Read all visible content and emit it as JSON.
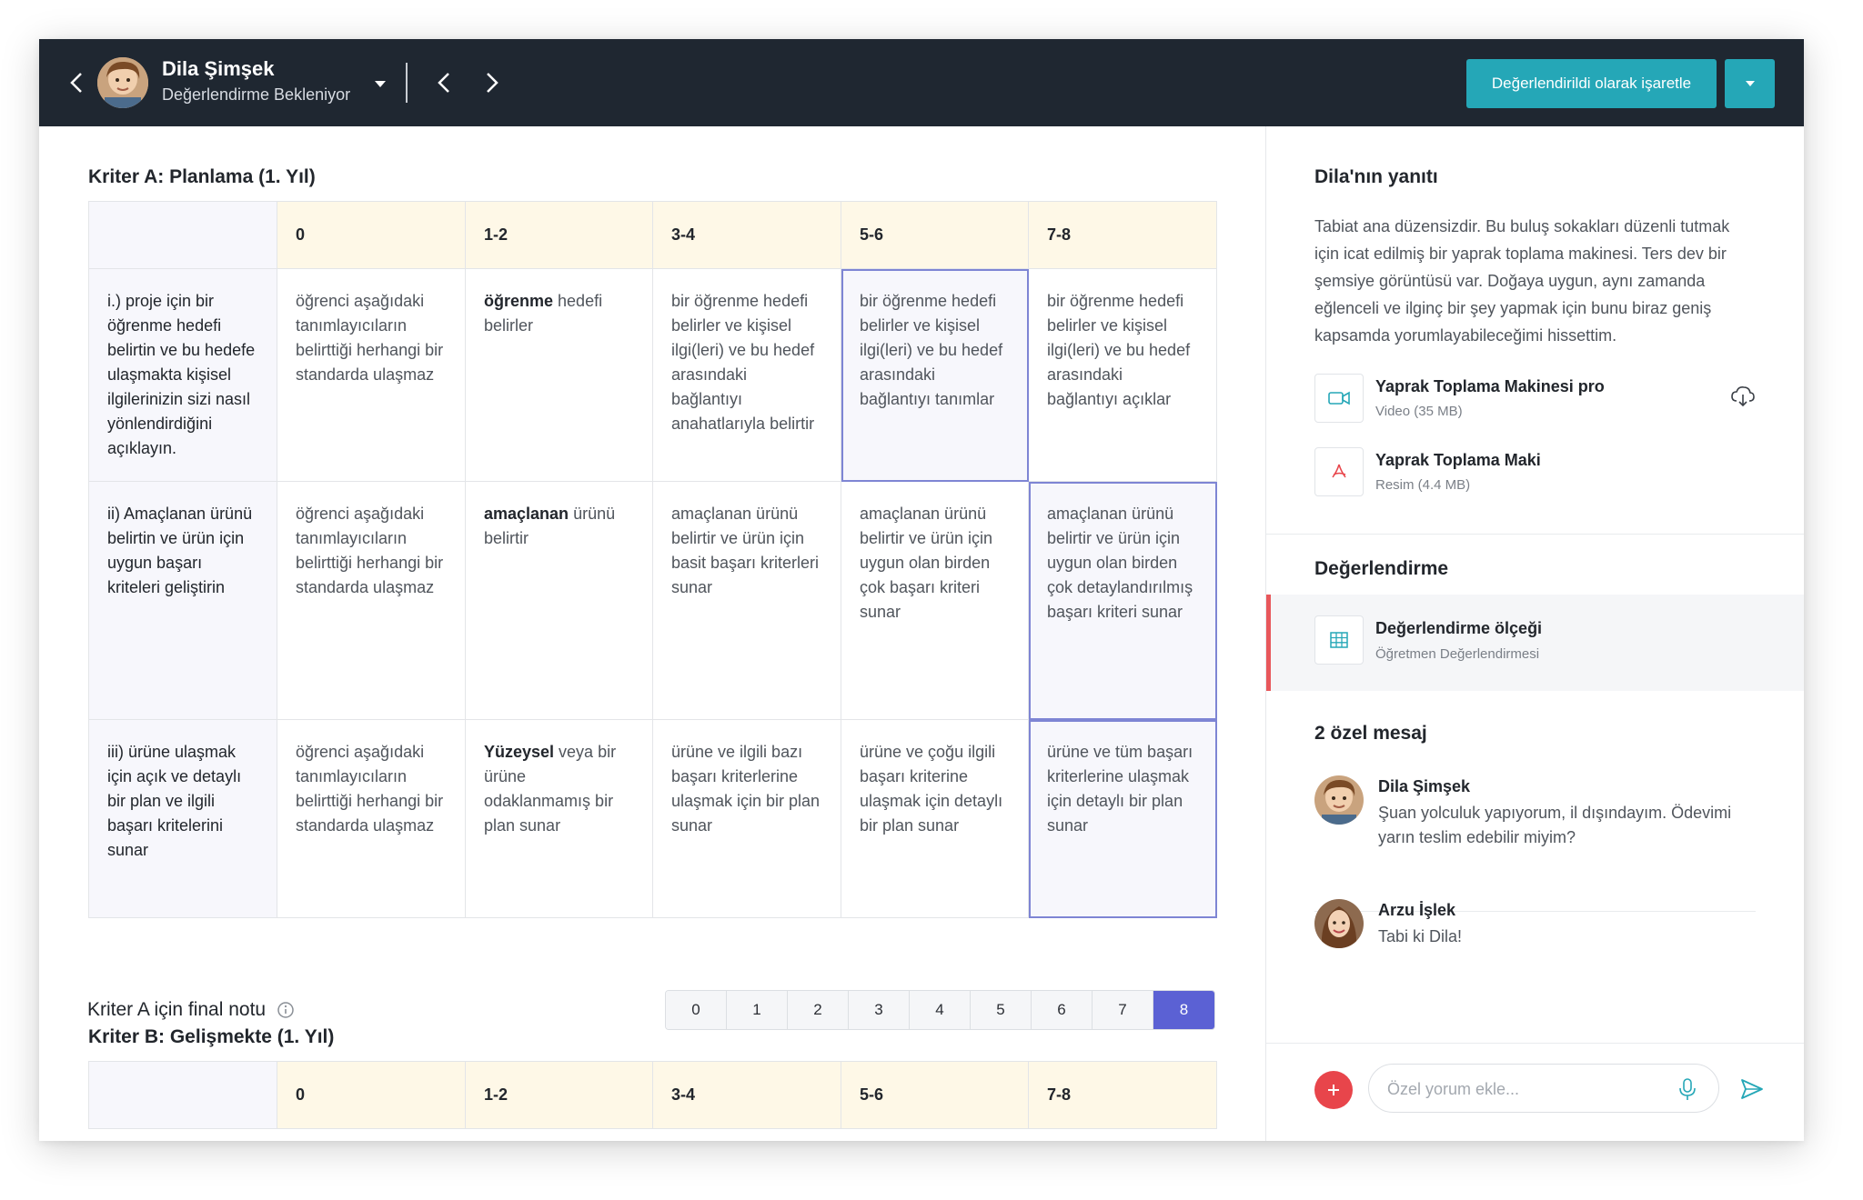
{
  "header": {
    "student_name": "Dila Şimşek",
    "student_status": "Değerlendirme Bekleniyor",
    "mark_button": "Değerlendirildi olarak işaretle",
    "accent": "#25a7b7",
    "bg": "#1f2731"
  },
  "criterion_a": {
    "title": "Kriter A: Planlama (1. Yıl)",
    "levels": [
      "0",
      "1-2",
      "3-4",
      "5-6",
      "7-8"
    ],
    "rows": [
      {
        "descriptor": "i.) proje için bir öğrenme hedefi belirtin ve bu hedefe ulaşmakta kişisel ilgilerinizin sizi nasıl yönlendirdiğini açıklayın.",
        "cells": [
          "öğrenci aşağıdaki tanımlayıcıların belirttiği herhangi bir standarda ulaşmaz",
          {
            "bold": "öğrenme",
            "rest": " hedefi belirler"
          },
          "bir öğrenme hedefi belirler ve kişisel ilgi(leri) ve bu hedef arasındaki bağlantıyı anahatlarıyla belirtir",
          "bir öğrenme hedefi belirler ve kişisel ilgi(leri) ve bu hedef arasındaki bağlantıyı tanımlar",
          "bir öğrenme hedefi belirler ve kişisel ilgi(leri) ve bu hedef arasındaki bağlantıyı açıklar"
        ],
        "selected_level": "5-6"
      },
      {
        "descriptor": "ii) Amaçlanan ürünü belirtin ve ürün için uygun başarı kriteleri geliştirin",
        "cells": [
          "öğrenci aşağıdaki tanımlayıcıların belirttiği herhangi bir standarda ulaşmaz",
          {
            "bold": "amaçlanan",
            "rest": " ürünü belirtir"
          },
          "amaçlanan ürünü belirtir ve ürün için basit başarı kriterleri sunar",
          "amaçlanan ürünü belirtir ve ürün için uygun olan birden çok başarı kriteri sunar",
          "amaçlanan ürünü belirtir ve ürün için uygun olan birden çok detaylandırılmış başarı kriteri sunar"
        ],
        "selected_level": "7-8"
      },
      {
        "descriptor": "iii) ürüne ulaşmak için açık ve detaylı bir plan ve ilgili başarı kritelerini sunar",
        "cells": [
          "öğrenci aşağıdaki tanımlayıcıların belirttiği herhangi bir standarda ulaşmaz",
          {
            "bold": "Yüzeysel",
            "rest": " veya bir ürüne odaklanmamış bir plan sunar"
          },
          "ürüne ve ilgili bazı başarı kriterlerine ulaşmak için bir plan sunar",
          "ürüne ve çoğu ilgili başarı kriterine ulaşmak için detaylı bir plan sunar",
          "ürüne ve tüm başarı kriterlerine ulaşmak için detaylı bir plan sunar"
        ],
        "selected_level": "7-8"
      }
    ],
    "final_label": "Kriter A için final notu",
    "scores": [
      "0",
      "1",
      "2",
      "3",
      "4",
      "5",
      "6",
      "7",
      "8"
    ],
    "selected_score": "8",
    "selected_color": "#5b61d4"
  },
  "criterion_b": {
    "title": "Kriter B: Gelişmekte (1. Yıl)",
    "levels": [
      "0",
      "1-2",
      "3-4",
      "5-6",
      "7-8"
    ]
  },
  "panel": {
    "response_title": "Dila'nın yanıtı",
    "response_text": "Tabiat ana düzensizdir. Bu buluş sokakları düzenli tutmak için icat edilmiş bir yaprak toplama makinesi. Ters dev bir şemsiye görüntüsü var. Doğaya uygun, aynı zamanda eğlenceli ve ilginç bir şey yapmak için bunu biraz geniş kapsamda yorumlayabileceğimi hissettim.",
    "attachments": [
      {
        "title": "Yaprak Toplama Makinesi pro",
        "meta": "Video (35 MB)",
        "icon": "video-camera-icon"
      },
      {
        "title": "Yaprak Toplama Maki",
        "meta": "Resim (4.4 MB)",
        "icon": "pdf-icon"
      }
    ],
    "grading_title": "Değerlendirme",
    "grading_item": {
      "title": "Değerlendirme ölçeği",
      "meta": "Öğretmen Değerlendirmesi",
      "icon": "table-icon"
    },
    "messages_title": "2 özel mesaj",
    "messages": [
      {
        "name": "Dila Şimşek",
        "text": "Şuan yolculuk yapıyorum, il dışındayım. Ödevimi yarın teslim edebilir miyim?"
      },
      {
        "name": "Arzu İşlek",
        "text": "Tabi ki Dila!"
      }
    ],
    "comment_placeholder": "Özel yorum ekle..."
  }
}
